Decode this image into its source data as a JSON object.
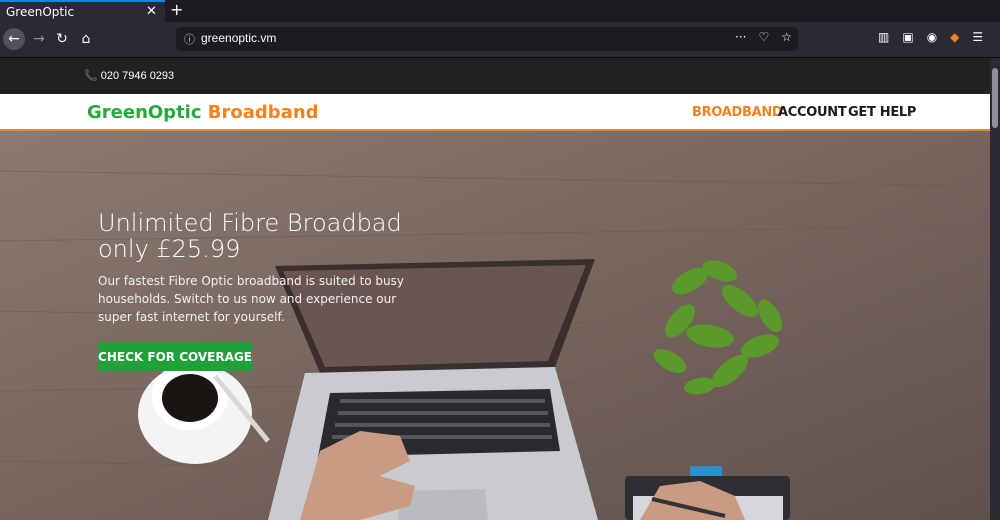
{
  "browser": {
    "tab_title": "GreenOptic",
    "tab_close": "✕",
    "new_tab": "+",
    "url": "greenoptic.vm",
    "icons": [
      "back-icon",
      "forward-icon",
      "reload-icon",
      "home-icon",
      "info-icon",
      "more-icon",
      "pocket-icon",
      "star-icon",
      "library-icon",
      "sidebar-icon",
      "account-icon",
      "extension-icon",
      "menu-icon"
    ]
  },
  "site": {
    "phone": "📞 020 7946 0293",
    "logo_green": "GreenOptic",
    "logo_orange": "Broadband",
    "menu": [
      "BROADBAND",
      "ACCOUNT",
      "GET HELP"
    ],
    "hero_title": "Unlimited Fibre Broadbad only £25.99",
    "hero_text": "Our fastest Fibre Optic broadband is suited to busy households. Switch to us now and experience our super fast internet for yourself.",
    "cta": "CHECK FOR COVERAGE"
  },
  "colors": {
    "brand_green": "#22aa3c",
    "brand_orange": "#f5801e",
    "cta_green": "#1fa13a"
  }
}
